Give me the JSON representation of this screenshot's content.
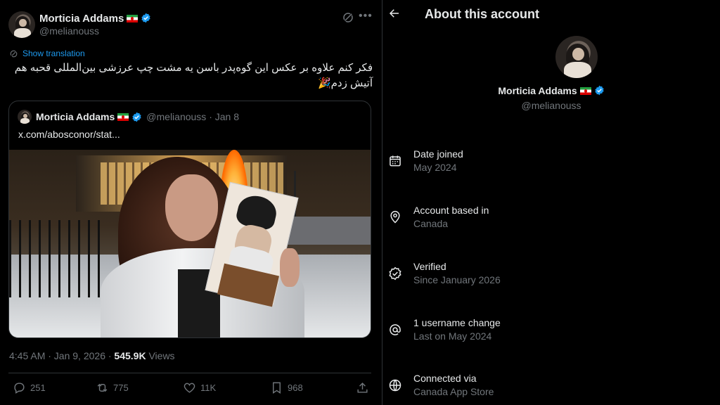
{
  "tweet": {
    "author": {
      "name": "Morticia Addams",
      "handle": "@melianouss"
    },
    "show_translation": "Show translation",
    "text": "فکر کنم علاوه بر عکس این گوه‌پدر باسن یه مشت چپ عرزشی بین‌المللی قحبه هم آتیش زدم🎉",
    "quote": {
      "author_name": "Morticia Addams",
      "author_handle": "@melianouss · Jan 8",
      "link": "x.com/abosconor/stat..."
    },
    "timestamp": "4:45 AM · Jan 9, 2026 · ",
    "views_count": "545.9K",
    "views_label": " Views",
    "actions": {
      "replies": "251",
      "reposts": "775",
      "likes": "11K",
      "bookmarks": "968"
    }
  },
  "about": {
    "title": "About this account",
    "name": "Morticia Addams",
    "handle": "@melianouss",
    "items": [
      {
        "label": "Date joined",
        "value": "May 2024",
        "icon": "calendar-icon"
      },
      {
        "label": "Account based in",
        "value": "Canada",
        "icon": "location-pin-icon"
      },
      {
        "label": "Verified",
        "value": "Since January 2026",
        "icon": "verified-badge-icon"
      },
      {
        "label": "1 username change",
        "value": "Last on May 2024",
        "icon": "at-sign-icon"
      },
      {
        "label": "Connected via",
        "value": "Canada App Store",
        "icon": "globe-icon"
      }
    ]
  },
  "colors": {
    "background": "#000000",
    "text_primary": "#e7e9ea",
    "text_secondary": "#71767b",
    "accent": "#1d9bf0",
    "border": "#2f3336"
  }
}
